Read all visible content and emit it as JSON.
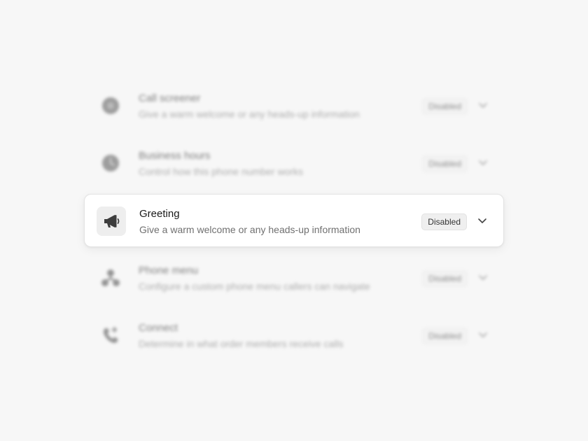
{
  "rows": [
    {
      "title": "Call screener",
      "subtitle": "Give a warm welcome or any heads-up information",
      "status": "Disabled",
      "icon": "call-screener-icon",
      "focused": false
    },
    {
      "title": "Business hours",
      "subtitle": "Control how this phone number works",
      "status": "Disabled",
      "icon": "clock-icon",
      "focused": false
    },
    {
      "title": "Greeting",
      "subtitle": "Give a warm welcome or any heads-up information",
      "status": "Disabled",
      "icon": "megaphone-icon",
      "focused": true
    },
    {
      "title": "Phone menu",
      "subtitle": "Configure a custom phone menu callers can navigate",
      "status": "Disabled",
      "icon": "phone-menu-icon",
      "focused": false
    },
    {
      "title": "Connect",
      "subtitle": "Determine in what order members receive calls",
      "status": "Disabled",
      "icon": "phone-connect-icon",
      "focused": false
    }
  ],
  "colors": {
    "background": "#f7f7f7",
    "card": "#ffffff",
    "icon": "#444444"
  }
}
